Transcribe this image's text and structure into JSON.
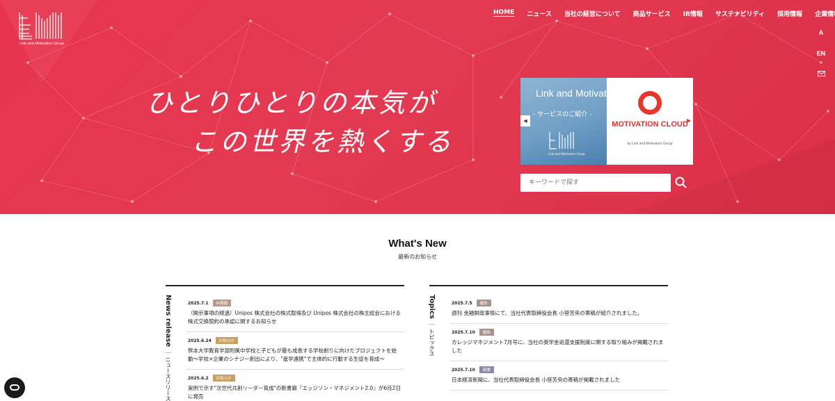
{
  "brand": {
    "logo_caption": "Link and Motivation Group"
  },
  "nav": {
    "items": [
      {
        "label": "HOME"
      },
      {
        "label": "ニュース"
      },
      {
        "label": "当社の経営について"
      },
      {
        "label": "商品サービス"
      },
      {
        "label": "IR情報"
      },
      {
        "label": "サステナビリティ"
      },
      {
        "label": "採用情報"
      },
      {
        "label": "企業情報"
      }
    ]
  },
  "tools": {
    "font_size": "A",
    "language": "EN",
    "mail_icon": "mail-icon"
  },
  "hero": {
    "catch_line1": "ひとりひとりの本気が",
    "catch_line2": "この世界を熱くする"
  },
  "banner": {
    "left_title": "Link and Motivation",
    "left_subtitle": "- サービスのご紹介 -",
    "left_logo_caption": "Link and Motivation Group",
    "right_title": "MOTIVATION CLOUD",
    "right_by": "by  Link and Motivation Group",
    "prev_icon": "chevron-left-icon",
    "next_icon": "chevron-right-icon"
  },
  "search": {
    "placeholder": "キーワードで探す",
    "button_icon": "search-icon"
  },
  "whats_new": {
    "title": "What's New",
    "subtitle": "最新のお知らせ"
  },
  "news_release": {
    "label_en": "News release",
    "label_jp": "ニュースリリース",
    "items": [
      {
        "date": "2025.7.1",
        "tag": "IR情報",
        "title": "（開示事項の経過）Unipos 株式会社の株式取得及び Unipos 株式会社の株主総会における株式交換契約の承認に関するお知らせ"
      },
      {
        "date": "2025.6.24",
        "tag": "お知らせ",
        "title": "熊本大学教育学部附属中学校と子どもが最も成長する学校創りに向けたプロジェクトを始動〜学校×企業のシナジー創出により、\"産学連携\"で主体的に行動する生徒を育成〜"
      },
      {
        "date": "2025.6.2",
        "tag": "お知らせ",
        "title": "実例で示す\"次世代共創リーダー育成\"の新書籍『エッジソン・マネジメント2.0』が6月2日に発売"
      }
    ]
  },
  "topics": {
    "label_en": "Topics",
    "label_jp": "トピックス",
    "items": [
      {
        "date": "2025.7.5",
        "tag": "雑誌",
        "title": "週刊 金融財政事情にて、当社代表取締役会長 小笹芳央の寄稿が紹介されました。"
      },
      {
        "date": "2025.7.10",
        "tag": "雑誌",
        "title": "カレッジマネジメント7月号に、当社の奨学金返還支援制度に関する取り組みが掲載されました"
      },
      {
        "date": "2025.7.10",
        "tag": "新聞",
        "title": "日本経済新聞に、当社代表取締役会長 小笹芳央の寄稿が掲載されました"
      }
    ]
  },
  "colors": {
    "hero_red": "#e4374f",
    "badge_ir": "#b59a8c",
    "badge_notice": "#c8a064",
    "badge_mag": "#a8928a",
    "badge_paper": "#8b8aa6"
  },
  "chat": {
    "icon": "chat-icon"
  }
}
